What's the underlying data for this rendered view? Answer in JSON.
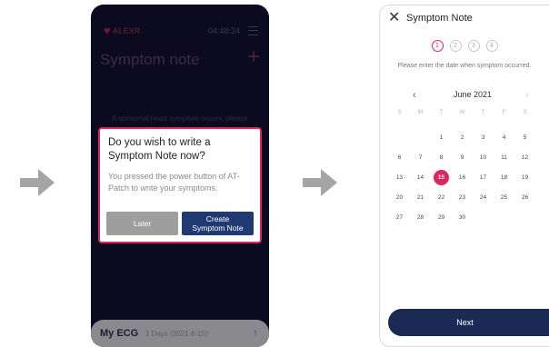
{
  "screen1": {
    "logo_text": "ALEXR",
    "time": "04:48:24",
    "title": "Symptom note",
    "add_symbol": "+",
    "background_text": "If abnormal heart symptom occurs, please enter the details by pressing the",
    "dialog": {
      "question": "Do you wish to write a Symptom Note now?",
      "description": "You pressed the power button of AT-Patch to write your symptoms.",
      "later_label": "Later",
      "create_label": "Create Symptom Note"
    },
    "ecg_bar": {
      "title": "My ECG",
      "subtitle": "1 Days (2021-6-15)",
      "arrow": "↑"
    }
  },
  "screen2": {
    "close_symbol": "✕",
    "title": "Symptom Note",
    "steps": [
      "1",
      "2",
      "3",
      "4"
    ],
    "active_step": 1,
    "instruction": "Please enter the date when symptom occurred.",
    "calendar": {
      "prev": "‹",
      "next": "›",
      "month_label": "June 2021",
      "weekdays": [
        "S",
        "M",
        "T",
        "W",
        "T",
        "F",
        "S"
      ],
      "leading_blanks": 2,
      "days": [
        "1",
        "2",
        "3",
        "4",
        "5",
        "6",
        "7",
        "8",
        "9",
        "10",
        "11",
        "12",
        "13",
        "14",
        "15",
        "16",
        "17",
        "18",
        "19",
        "20",
        "21",
        "22",
        "23",
        "24",
        "25",
        "26",
        "27",
        "28",
        "29",
        "30"
      ],
      "selected_day": "15"
    },
    "next_label": "Next"
  },
  "colors": {
    "accent": "#e0245e",
    "navy": "#1a2a55",
    "dark_bg": "#0c0a1f",
    "arrow": "#a5a5a5"
  },
  "icons": {
    "flow_arrow": "right-arrow-icon",
    "close": "close-icon",
    "menu": "hamburger-menu-icon",
    "add": "plus-icon"
  }
}
